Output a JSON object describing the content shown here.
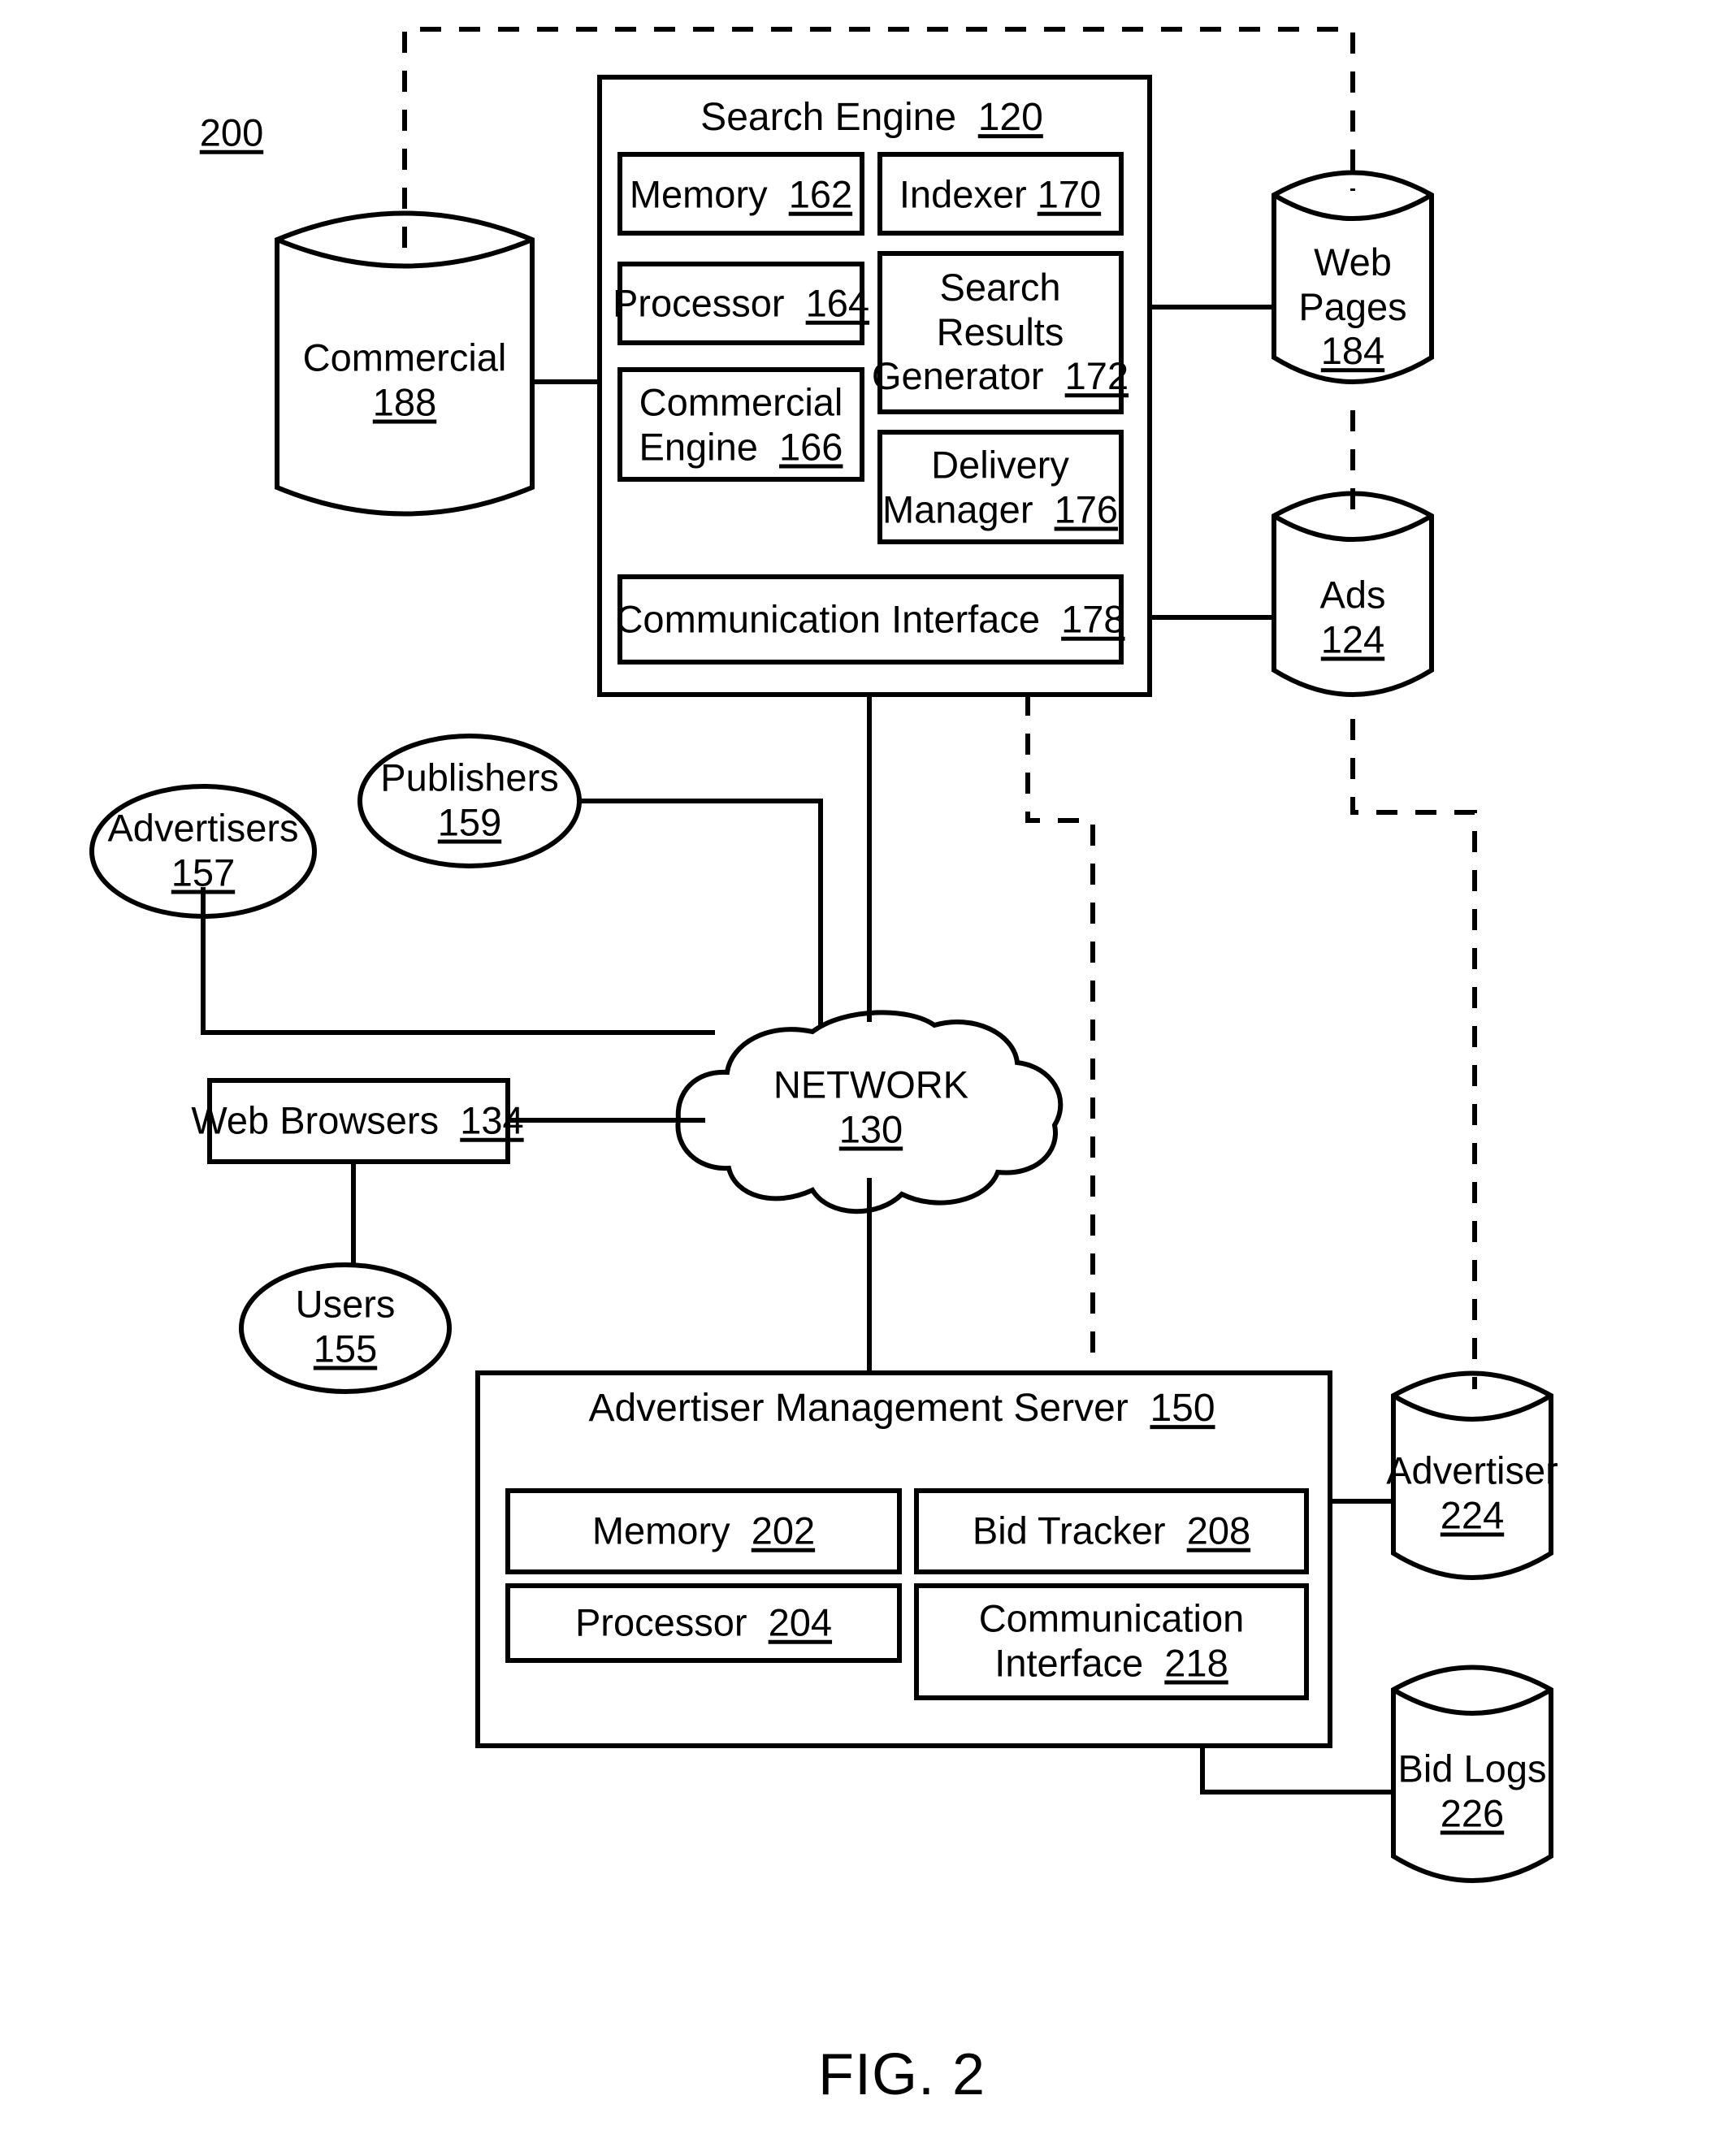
{
  "figure": {
    "caption": "FIG. 2",
    "diagram_ref": "200"
  },
  "search_engine": {
    "title": "Search Engine",
    "ref": "120",
    "components": [
      {
        "label": "Memory",
        "ref": "162"
      },
      {
        "label": "Indexer",
        "ref": "170"
      },
      {
        "label": "Processor",
        "ref": "164"
      },
      {
        "label": "Search\nResults\nGenerator",
        "ref": "172"
      },
      {
        "label": "Commercial\nEngine",
        "ref": "166"
      },
      {
        "label": "Delivery\nManager",
        "ref": "176"
      },
      {
        "label": "Communication Interface",
        "ref": "178"
      }
    ]
  },
  "advertiser_management_server": {
    "title": "Advertiser Management Server",
    "ref": "150",
    "components": [
      {
        "label": "Memory",
        "ref": "202"
      },
      {
        "label": "Bid Tracker",
        "ref": "208"
      },
      {
        "label": "Processor",
        "ref": "204"
      },
      {
        "label": "Communication\nInterface",
        "ref": "218"
      }
    ]
  },
  "datastores": [
    {
      "label": "Commercial",
      "ref": "188"
    },
    {
      "label": "Web\nPages",
      "ref": "184"
    },
    {
      "label": "Ads",
      "ref": "124"
    },
    {
      "label": "Advertiser",
      "ref": "224"
    },
    {
      "label": "Bid Logs",
      "ref": "226"
    }
  ],
  "actors": [
    {
      "label": "Advertisers",
      "ref": "157"
    },
    {
      "label": "Publishers",
      "ref": "159"
    },
    {
      "label": "Users",
      "ref": "155"
    }
  ],
  "nodes": [
    {
      "label": "Web Browsers",
      "ref": "134"
    },
    {
      "label": "NETWORK",
      "ref": "130"
    }
  ],
  "colors": {
    "stroke": "#000000",
    "background": "#ffffff"
  }
}
